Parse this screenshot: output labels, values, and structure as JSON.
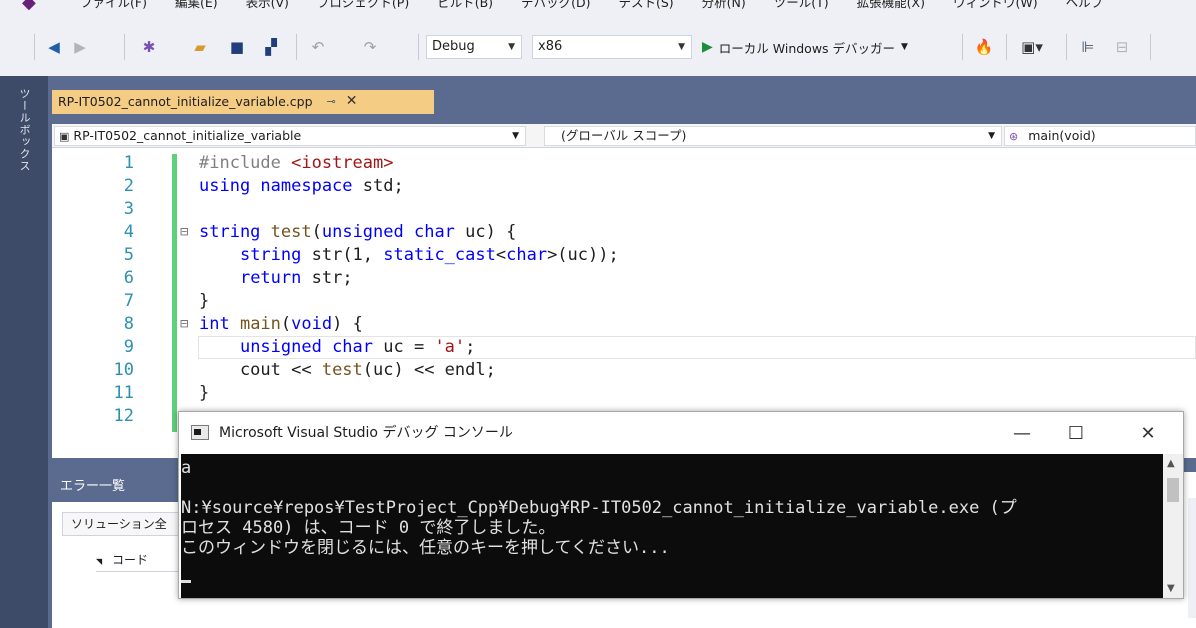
{
  "menu": {
    "items": [
      "ファイル(F)",
      "編集(E)",
      "表示(V)",
      "プロジェクト(P)",
      "ビルド(B)",
      "デバッグ(D)",
      "テスト(S)",
      "分析(N)",
      "ツール(T)",
      "拡張機能(X)",
      "ウィンドウ(W)",
      "ヘルプ"
    ]
  },
  "toolbar": {
    "config": "Debug",
    "platform": "x86",
    "run_label": "ローカル Windows デバッガー"
  },
  "toolbox": {
    "label": "ツールボックス"
  },
  "editor": {
    "tab_title": "RP-IT0502_cannot_initialize_variable.cpp",
    "nav_project": "RP-IT0502_cannot_initialize_variable",
    "nav_scope": "(グローバル スコープ)",
    "nav_member": "main(void)",
    "lines": [
      {
        "num": "1",
        "fold": "",
        "parts": [
          [
            "pp",
            "#include "
          ],
          [
            "str",
            "<iostream>"
          ]
        ]
      },
      {
        "num": "2",
        "fold": "",
        "parts": [
          [
            "kw",
            "using namespace "
          ],
          [
            "",
            "std;"
          ]
        ]
      },
      {
        "num": "3",
        "fold": "",
        "parts": []
      },
      {
        "num": "4",
        "fold": "⊟",
        "parts": [
          [
            "kw",
            "string "
          ],
          [
            "fn",
            "test"
          ],
          [
            "",
            "("
          ],
          [
            "kw",
            "unsigned char "
          ],
          [
            "",
            "uc) {"
          ]
        ]
      },
      {
        "num": "5",
        "fold": "",
        "parts": [
          [
            "",
            "    "
          ],
          [
            "kw",
            "string "
          ],
          [
            "",
            "str(1, "
          ],
          [
            "kw",
            "static_cast"
          ],
          [
            "",
            "<"
          ],
          [
            "kw",
            "char"
          ],
          [
            "",
            ">(uc));"
          ]
        ]
      },
      {
        "num": "6",
        "fold": "",
        "parts": [
          [
            "",
            "    "
          ],
          [
            "kw",
            "return "
          ],
          [
            "",
            "str;"
          ]
        ]
      },
      {
        "num": "7",
        "fold": "",
        "parts": [
          [
            "",
            "}"
          ]
        ]
      },
      {
        "num": "8",
        "fold": "⊟",
        "parts": [
          [
            "kw",
            "int "
          ],
          [
            "fn",
            "main"
          ],
          [
            "",
            "("
          ],
          [
            "kw",
            "void"
          ],
          [
            "",
            ") {"
          ]
        ]
      },
      {
        "num": "9",
        "fold": "",
        "parts": [
          [
            "",
            "    "
          ],
          [
            "kw",
            "unsigned char "
          ],
          [
            "",
            "uc = "
          ],
          [
            "str",
            "'a'"
          ],
          [
            "",
            ";"
          ]
        ]
      },
      {
        "num": "10",
        "fold": "",
        "parts": [
          [
            "",
            "    cout << "
          ],
          [
            "fn",
            "test"
          ],
          [
            "",
            "(uc) << endl;"
          ]
        ]
      },
      {
        "num": "11",
        "fold": "",
        "parts": [
          [
            "",
            "}"
          ]
        ]
      },
      {
        "num": "12",
        "fold": "",
        "parts": []
      }
    ]
  },
  "error_panel": {
    "title": "エラー一覧",
    "solution_filter": "ソリューション全",
    "code_column": "コード"
  },
  "console": {
    "title": "Microsoft Visual Studio デバッグ コンソール",
    "minimize": "—",
    "maximize": "☐",
    "close": "✕",
    "lines": [
      "a",
      "",
      "N:¥source¥repos¥TestProject_Cpp¥Debug¥RP-IT0502_cannot_initialize_variable.exe (プ",
      "ロセス 4580) は、コード 0 で終了しました。",
      "このウィンドウを閉じるには、任意のキーを押してください..."
    ]
  }
}
